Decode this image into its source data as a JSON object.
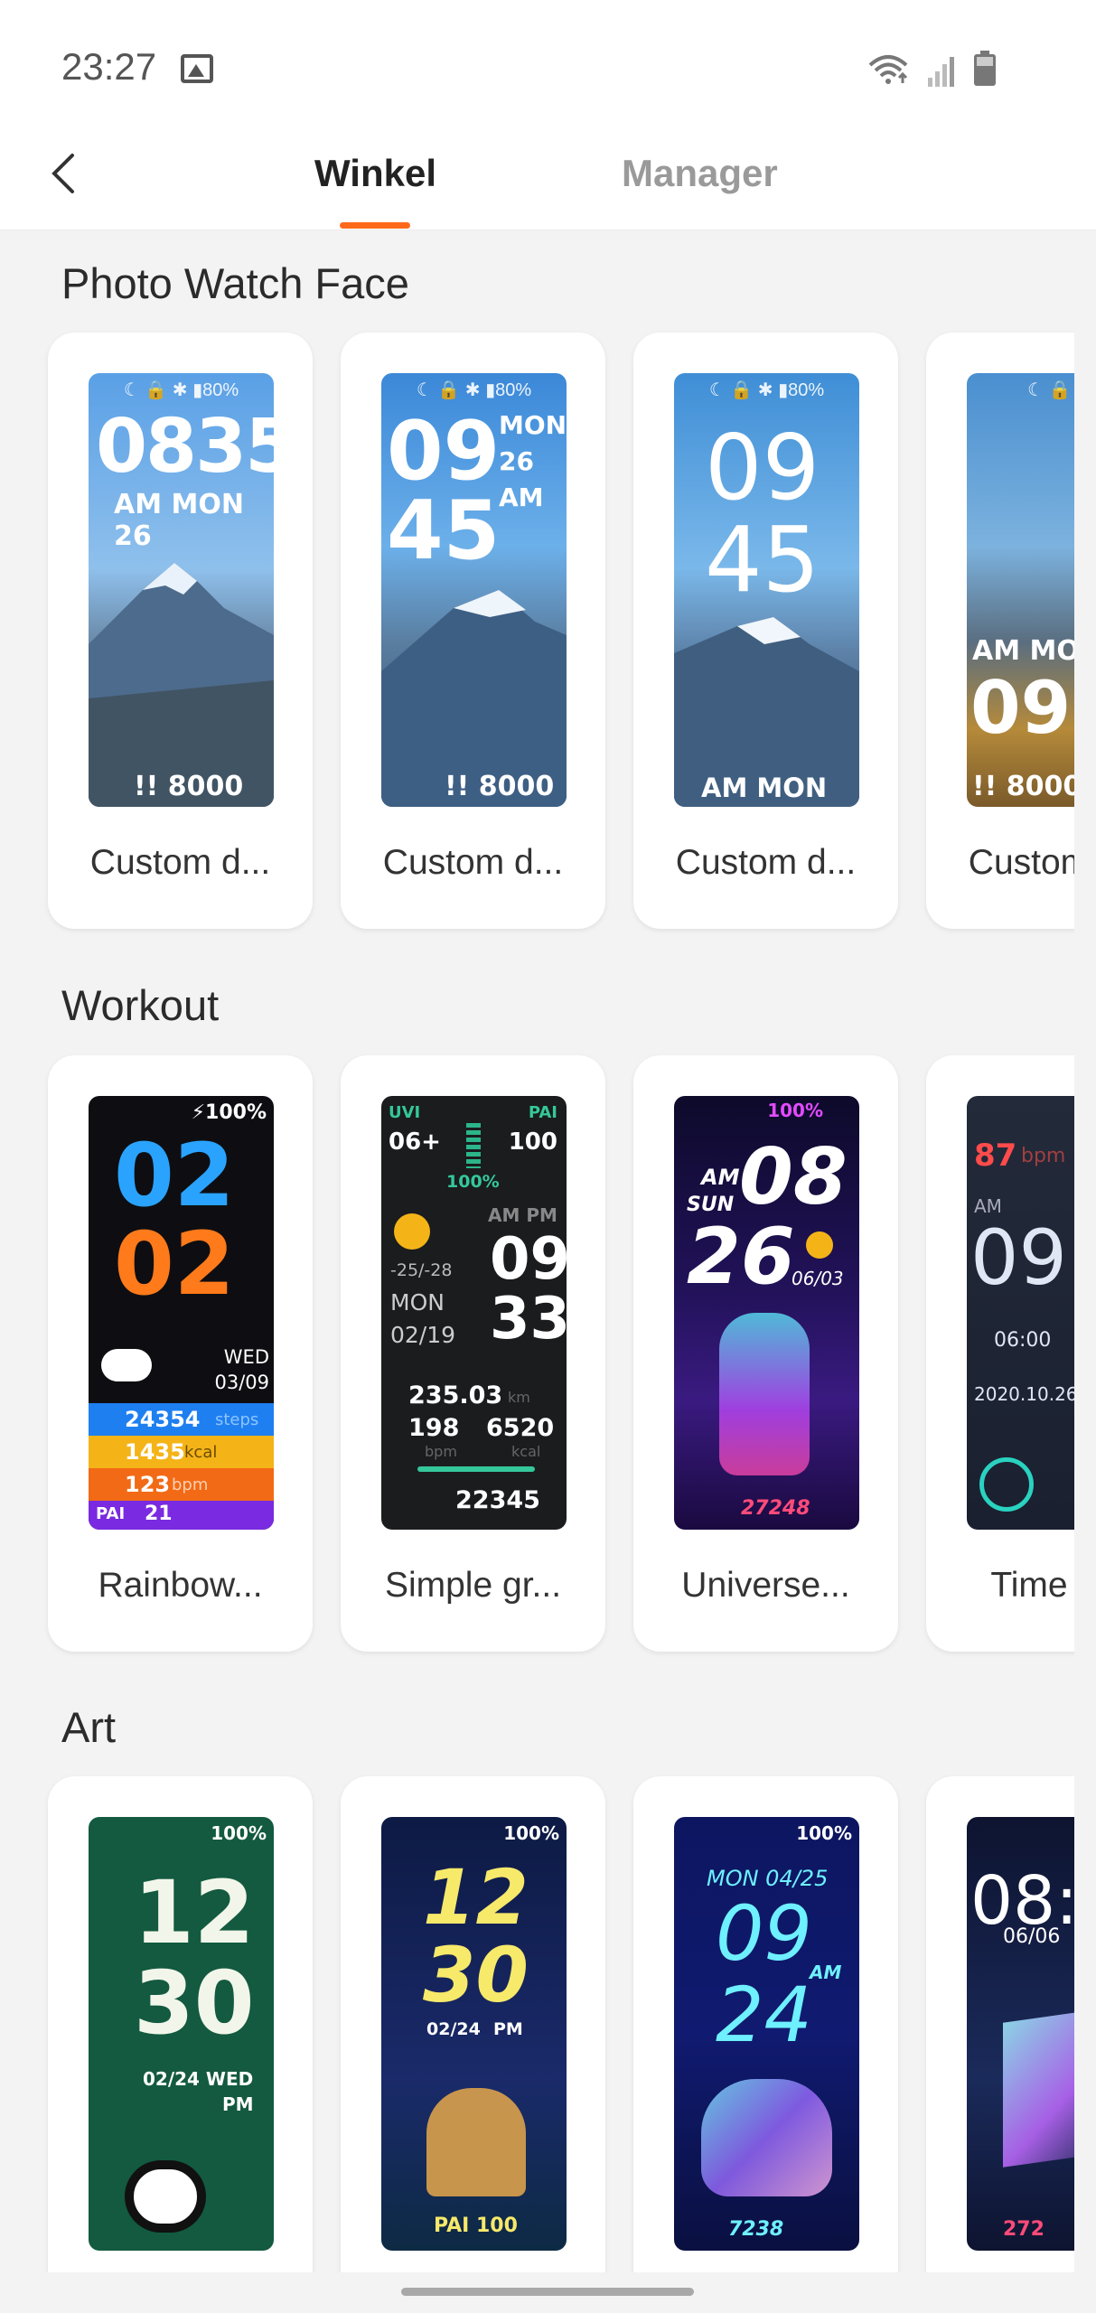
{
  "status_bar": {
    "time": "23:27",
    "icons": [
      "image-icon",
      "wifi-icon",
      "signal-icon",
      "battery-icon"
    ]
  },
  "header": {
    "back_icon": "chevron-left-icon",
    "tabs": [
      {
        "label": "Winkel",
        "active": true
      },
      {
        "label": "Manager",
        "active": false
      }
    ],
    "accent_color": "#ff6a1a"
  },
  "sections": [
    {
      "title": "Photo Watch Face",
      "cards": [
        {
          "label": "Custom d...",
          "face": {
            "status": "☾ 🔒 ✱ ▮80%",
            "line1": "0835",
            "line2": "AM MON 26",
            "footer": "!! 8000"
          }
        },
        {
          "label": "Custom d...",
          "face": {
            "status": "☾ 🔒 ✱ ▮80%",
            "line1": "09",
            "line2": "45",
            "side": "MON 26 AM",
            "footer": "!! 8000"
          }
        },
        {
          "label": "Custom d...",
          "face": {
            "status": "☾ 🔒 ✱ ▮80%",
            "line1": "09",
            "line2": "45",
            "footer": "AM MON 26"
          }
        },
        {
          "label": "Custom d...",
          "face": {
            "status": "☾ 🔒 ✱",
            "line1": "AM MO",
            "line2": "09",
            "footer": "!! 8000"
          }
        }
      ]
    },
    {
      "title": "Workout",
      "cards": [
        {
          "label": "Rainbow...",
          "face": {
            "status": "⚡100%",
            "line1": "02",
            "line2": "02",
            "date": "WED 03/09",
            "steps": "24354",
            "steps_unit": "steps",
            "kcal": "1435",
            "kcal_unit": "kcal",
            "bpm": "123",
            "bpm_unit": "bpm",
            "pai_label": "PAI",
            "pai": "21"
          }
        },
        {
          "label": "Simple gr...",
          "face": {
            "uvi_label": "UVI",
            "uvi": "06+",
            "pai_label": "PAI",
            "pai": "100",
            "percent": "100%",
            "ampm": "AM PM",
            "line1": "09",
            "line2": "33",
            "temp": "-25/-28",
            "day": "MON",
            "date": "02/19",
            "distance": "235.03",
            "dist_unit": "km",
            "hr": "198",
            "hr_unit": "bpm",
            "kcal": "6520",
            "kcal_unit": "kcal",
            "steps": "22345"
          }
        },
        {
          "label": "Universe...",
          "face": {
            "status": "100%",
            "ampm": "AM",
            "day": "SUN",
            "line1": "08",
            "line2": "26",
            "date": "06/03",
            "steps": "27248"
          }
        },
        {
          "label": "Time a...",
          "face": {
            "hr": "87",
            "hr_unit": "bpm",
            "ampm": "AM",
            "line1": "09:",
            "alarm": "06:00",
            "date": "2020.10.26"
          }
        }
      ]
    },
    {
      "title": "Art",
      "cards": [
        {
          "label": "",
          "face": {
            "status": "100%",
            "line1": "12",
            "line2": "30",
            "date": "02/24 WED",
            "ampm": "PM"
          }
        },
        {
          "label": "",
          "face": {
            "status": "100%",
            "line1": "12",
            "line2": "30",
            "date": "02/24",
            "ampm": "PM",
            "pai": "PAI 100"
          }
        },
        {
          "label": "",
          "face": {
            "status": "100%",
            "date": "MON 04/25",
            "line1": "09",
            "ampm": "AM",
            "line2": "24",
            "steps": "7238"
          }
        },
        {
          "label": "",
          "face": {
            "line1": "08:",
            "date": "06/06",
            "steps": "272"
          }
        }
      ]
    }
  ]
}
